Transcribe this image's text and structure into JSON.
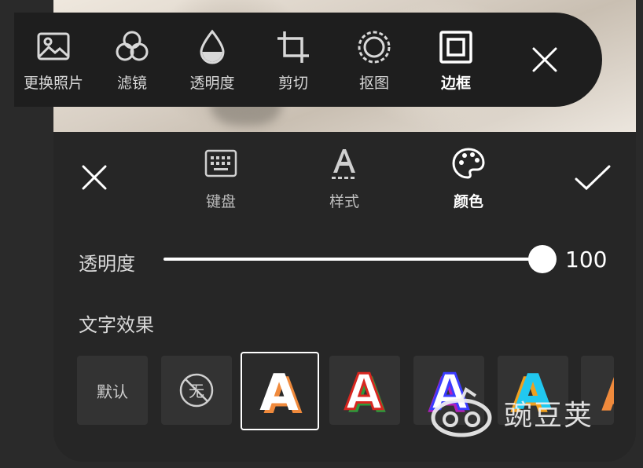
{
  "toolbar": {
    "items": [
      {
        "label": "更换照片",
        "icon": "image-icon"
      },
      {
        "label": "滤镜",
        "icon": "filter-icon"
      },
      {
        "label": "透明度",
        "icon": "opacity-drop-icon"
      },
      {
        "label": "剪切",
        "icon": "crop-icon"
      },
      {
        "label": "抠图",
        "icon": "cutout-icon"
      },
      {
        "label": "边框",
        "icon": "border-frame-icon",
        "active": true
      }
    ],
    "close_icon": "close-icon"
  },
  "text_panel": {
    "tabs": [
      {
        "label": "键盘",
        "icon": "keyboard-icon"
      },
      {
        "label": "样式",
        "icon": "text-style-icon"
      },
      {
        "label": "颜色",
        "icon": "palette-icon",
        "active": true
      }
    ],
    "cancel_icon": "close-icon",
    "confirm_icon": "check-icon",
    "opacity": {
      "label": "透明度",
      "value": "100",
      "level": 1.0
    },
    "effects": {
      "label": "文字效果",
      "items": [
        {
          "label": "默认"
        },
        {
          "label": "无"
        },
        {
          "glyph": "A",
          "style": "orange-shadow",
          "selected": true
        },
        {
          "glyph": "A",
          "style": "red-green-outline"
        },
        {
          "glyph": "A",
          "style": "purple-blue-outline"
        },
        {
          "glyph": "A",
          "style": "cyan-orange-shadow"
        },
        {
          "glyph": "A",
          "style": "orange-partial"
        }
      ]
    }
  },
  "watermark": {
    "text": "豌豆荚"
  },
  "colors": {
    "panel_bg": "#262626",
    "toolbar_bg": "#1e1e1e",
    "page_bg": "#2a2a2a",
    "accent": "#ffffff"
  }
}
